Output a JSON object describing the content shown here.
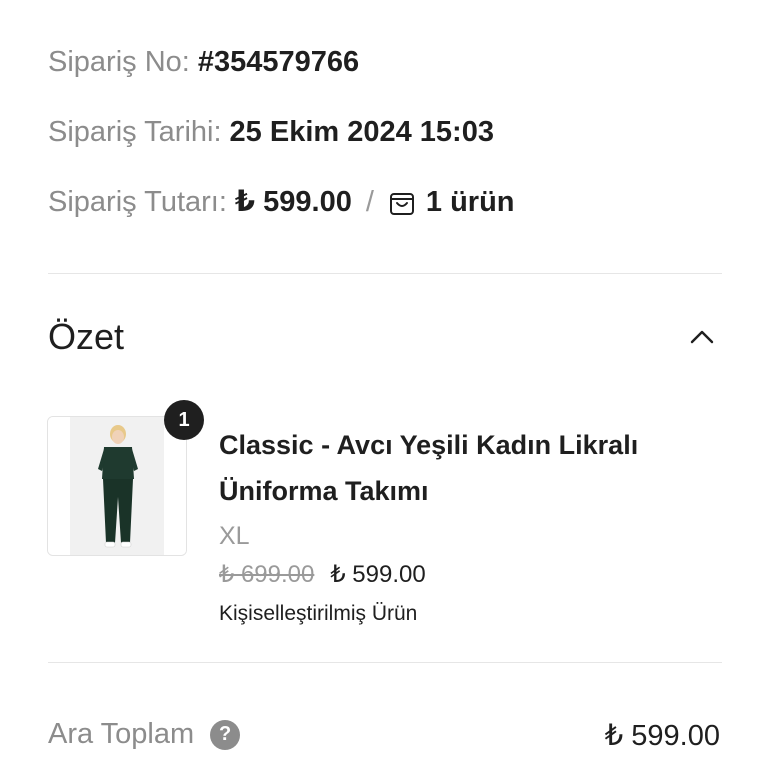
{
  "order": {
    "number_label": "Sipariş No:",
    "number_value": "#354579766",
    "date_label": "Sipariş Tarihi:",
    "date_value": "25 Ekim 2024 15:03",
    "total_label": "Sipariş Tutarı:",
    "total_value": "₺ 599.00",
    "separator": "/",
    "item_count": "1 ürün",
    "bag_icon": "shopping-bag-icon"
  },
  "summary": {
    "title": "Özet",
    "collapse_icon": "chevron-up-icon",
    "item": {
      "quantity_badge": "1",
      "name": "Classic - Avcı Yeşili Kadın Likralı Üniforma Takımı",
      "variant": "XL",
      "old_price": "₺ 699.00",
      "price": "₺ 599.00",
      "note": "Kişiselleştirilmiş Ürün"
    }
  },
  "totals": {
    "subtotal_label": "Ara Toplam",
    "help_icon": "question-mark-icon",
    "help_glyph": "?",
    "subtotal_value": "₺ 599.00"
  },
  "colors": {
    "label_gray": "#8c8c8c",
    "text_dark": "#1f1f1f",
    "badge_bg": "#1f1f1f",
    "divider": "#e6e6e6",
    "scrub_green": "#1f3a2f"
  }
}
